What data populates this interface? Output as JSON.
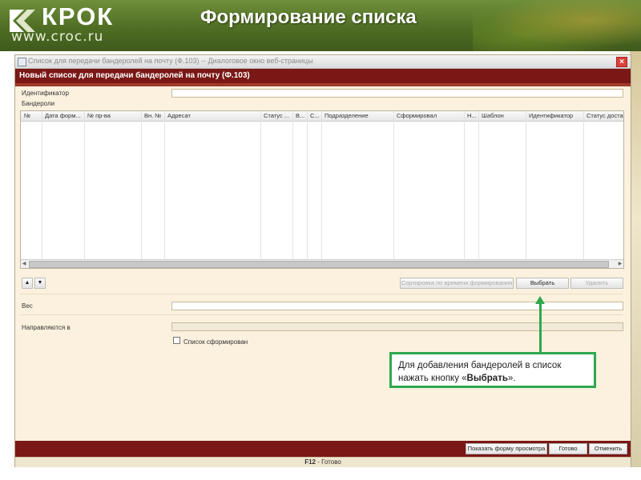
{
  "header": {
    "brand": "КРОК",
    "site": "www.croc.ru",
    "title": "Формирование списка"
  },
  "window": {
    "titlebar": "Список для передачи бандеролей на почту (Ф.103) -- Диалоговое окно веб-страницы",
    "close_label": "×",
    "heading": "Новый список для передачи бандеролей на почту (Ф.103)"
  },
  "form": {
    "identifier_label": "Идентификатор",
    "identifier_value": "",
    "parcels_label": "Бандероли",
    "weight_label": "Вес",
    "weight_value": "",
    "sent_to_label": "Направляются в",
    "sent_to_value": "",
    "list_formed_label": "Список сформирован"
  },
  "table": {
    "columns": [
      "№",
      "Дата форм...",
      "№ пр-ва",
      "Вн. №",
      "Адресат",
      "Статус ...",
      "В...",
      "С...",
      "Подразделение",
      "Сформировал",
      "Н...",
      "Шаблон",
      "Идентификатор",
      "Статус доставки"
    ],
    "rows": []
  },
  "toolbar": {
    "up_label": "▲",
    "down_label": "▼",
    "sort_label": "Сортировка по времени формирования",
    "select_label": "Выбрать",
    "delete_label": "Удалить"
  },
  "footer": {
    "preview_label": "Показать форму просмотра",
    "done_label": "Готово",
    "cancel_label": "Отменить",
    "status_key": "F12",
    "status_text": " - Готово"
  },
  "callout": {
    "text_prefix": "Для добавления бандеролей в список нажать кнопку «",
    "text_bold": "Выбрать",
    "text_suffix": "»."
  },
  "colors": {
    "header_green": "#4f6e24",
    "maroon": "#7a1816",
    "window_bg": "#fbf1de",
    "callout_green": "#2fa84f"
  }
}
